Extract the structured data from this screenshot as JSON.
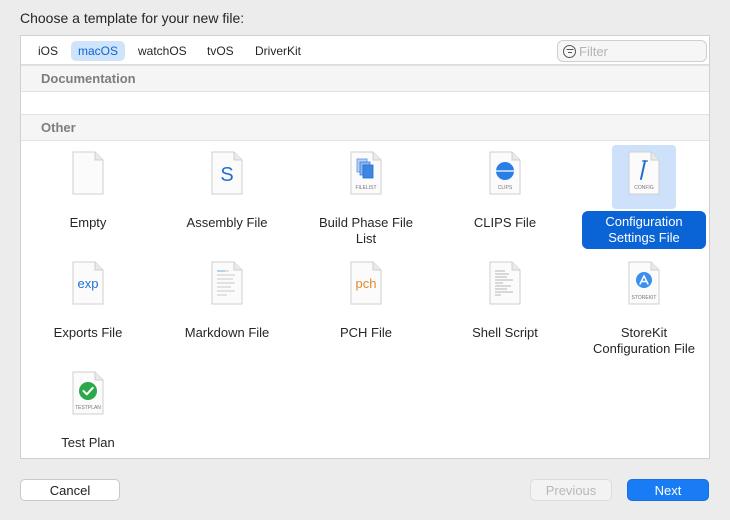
{
  "dialog": {
    "title": "Choose a template for your new file:"
  },
  "tabs": [
    {
      "label": "iOS",
      "selected": false
    },
    {
      "label": "macOS",
      "selected": true
    },
    {
      "label": "watchOS",
      "selected": false
    },
    {
      "label": "tvOS",
      "selected": false
    },
    {
      "label": "DriverKit",
      "selected": false
    }
  ],
  "filter": {
    "placeholder": "Filter",
    "value": ""
  },
  "sections": {
    "documentation": "Documentation",
    "other": "Other"
  },
  "templates": [
    {
      "label": "Empty",
      "icon": "blank-document-icon",
      "selected": false
    },
    {
      "label": "Assembly File",
      "icon": "assembly-file-icon",
      "glyph": "S",
      "selected": false
    },
    {
      "label": "Build Phase File List",
      "icon": "filelist-icon",
      "tag": "FILELIST",
      "selected": false
    },
    {
      "label": "CLIPS File",
      "icon": "clips-file-icon",
      "tag": "CLIPS",
      "selected": false
    },
    {
      "label": "Configuration Settings File",
      "icon": "config-file-icon",
      "tag": "CONFIG",
      "selected": true
    },
    {
      "label": "Exports File",
      "icon": "exports-file-icon",
      "glyph": "exp",
      "selected": false
    },
    {
      "label": "Markdown File",
      "icon": "markdown-file-icon",
      "selected": false
    },
    {
      "label": "PCH File",
      "icon": "pch-file-icon",
      "glyph": "pch",
      "selected": false
    },
    {
      "label": "Shell Script",
      "icon": "shell-script-icon",
      "selected": false
    },
    {
      "label": "StoreKit Configuration File",
      "icon": "storekit-file-icon",
      "tag": "STOREKIT",
      "selected": false
    },
    {
      "label": "Test Plan",
      "icon": "test-plan-icon",
      "tag": "TESTPLAN",
      "selected": false
    }
  ],
  "buttons": {
    "cancel": "Cancel",
    "previous": "Previous",
    "next": "Next"
  },
  "colors": {
    "accent": "#0a64d6",
    "next_button": "#1a7cf4",
    "selection_bg": "#cde1fb"
  }
}
